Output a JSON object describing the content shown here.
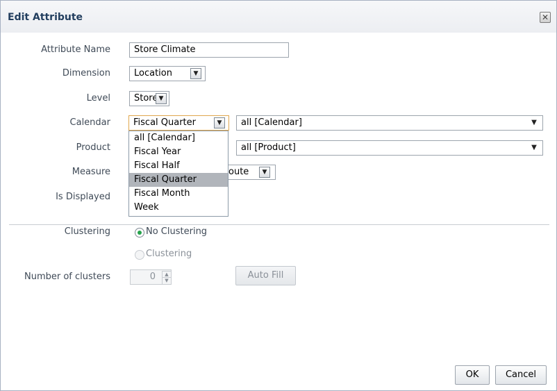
{
  "dialog": {
    "title": "Edit Attribute",
    "close_icon": "close-icon"
  },
  "form": {
    "attribute_name": {
      "label": "Attribute Name",
      "value": "Store Climate"
    },
    "dimension": {
      "label": "Dimension",
      "value": "Location"
    },
    "level": {
      "label": "Level",
      "value": "Store"
    },
    "calendar": {
      "label": "Calendar",
      "value": "Fiscal Quarter",
      "scope_value": "all [Calendar]"
    },
    "product": {
      "label": "Product",
      "scope_value": "all [Product]"
    },
    "measure": {
      "label": "Measure",
      "value_partial": "oute"
    },
    "is_displayed": {
      "label": "Is Displayed"
    },
    "calendar_dropdown": {
      "options": [
        "all [Calendar]",
        "Fiscal Year",
        "Fiscal Half",
        "Fiscal Quarter",
        "Fiscal Month",
        "Week"
      ],
      "highlighted": "Fiscal Quarter"
    },
    "clustering": {
      "label": "Clustering",
      "option_none": "No Clustering",
      "option_clustering": "Clustering",
      "selected": "No Clustering"
    },
    "number_of_clusters": {
      "label": "Number of clusters",
      "value": "0"
    },
    "auto_fill_label": "Auto Fill"
  },
  "footer": {
    "ok_label": "OK",
    "cancel_label": "Cancel"
  },
  "colors": {
    "title": "#233f5f",
    "label": "#3f4a57",
    "highlight": "#b1b5bb",
    "radio_on": "#26a34b"
  }
}
